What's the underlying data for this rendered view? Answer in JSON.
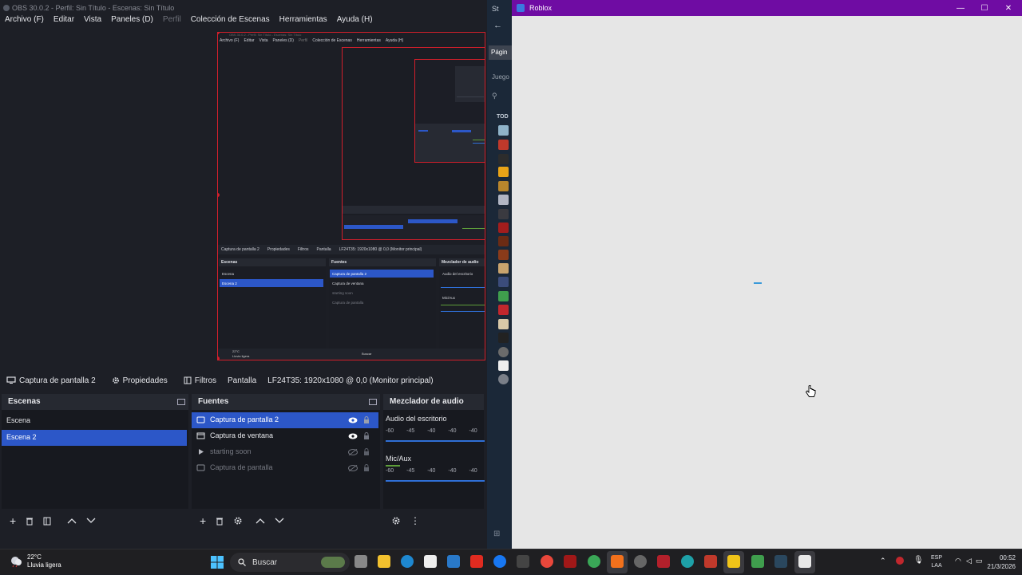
{
  "obs": {
    "title": "OBS 30.0.2 - Perfil: Sin Título - Escenas: Sin Título",
    "menu": [
      "Archivo (F)",
      "Editar",
      "Vista",
      "Paneles (D)",
      "Perfil",
      "Colección de Escenas",
      "Herramientas",
      "Ayuda (H)"
    ],
    "source_toolbar": {
      "selected_source": "Captura de pantalla 2",
      "properties": "Propiedades",
      "filters": "Filtros",
      "display_label": "Pantalla",
      "display_value": "LF24T35: 1920x1080 @ 0,0 (Monitor principal)"
    },
    "scenes": {
      "title": "Escenas",
      "items": [
        {
          "label": "Escena",
          "selected": false
        },
        {
          "label": "Escena 2",
          "selected": true
        }
      ]
    },
    "sources": {
      "title": "Fuentes",
      "items": [
        {
          "label": "Captura de pantalla 2",
          "selected": true,
          "visible": true,
          "type": "monitor"
        },
        {
          "label": "Captura de ventana",
          "selected": false,
          "visible": true,
          "type": "window"
        },
        {
          "label": "starting soon",
          "selected": false,
          "visible": false,
          "type": "media"
        },
        {
          "label": "Captura de pantalla",
          "selected": false,
          "visible": false,
          "type": "monitor"
        }
      ]
    },
    "mixer": {
      "title": "Mezclador de audio",
      "channels": [
        {
          "name": "Audio del escritorio",
          "ticks": [
            "-60",
            "-45",
            "-40",
            "-40",
            "-40"
          ]
        },
        {
          "name": "Mic/Aux",
          "ticks": [
            "-60",
            "-45",
            "-40",
            "-40",
            "-40"
          ]
        }
      ]
    },
    "inner_preview": {
      "title": "OBS 30.0.2 - Perfil: Sin Título - Escenas: Sin Título",
      "menu": [
        "Archivo (F)",
        "Editar",
        "Vista",
        "Paneles (D)",
        "Perfil",
        "Colección de Escenas",
        "Herramientas",
        "Ayuda (H)"
      ],
      "toolbar": [
        "Captura de pantalla 2",
        "Propiedades",
        "Filtros",
        "Pantalla",
        "LF24T35: 1920x1080 @ 0,0 (Monitor principal)"
      ],
      "scenes_title": "Escenas",
      "scenes": [
        "Escena",
        "Escena 2"
      ],
      "sources_title": "Fuentes",
      "sources": [
        "Captura de pantalla 2",
        "Captura de ventana",
        "starting soon",
        "Captura de pantalla"
      ],
      "mixer_title": "Mezclador de audio",
      "mixer_channels": [
        "Audio del escritorio",
        "Mic/Aux"
      ],
      "weather": "22°C",
      "weather_desc": "Lluvia ligera",
      "search": "Buscar"
    }
  },
  "steam": {
    "title": "St",
    "tab_label": "Págin",
    "section": "Juego",
    "filter": "TOD"
  },
  "roblox": {
    "title": "Roblox",
    "minimize": "—",
    "maximize": "☐",
    "close": "✕",
    "accent": "#6f0ca3"
  },
  "taskbar": {
    "weather_temp": "22°C",
    "weather_desc": "Lluvia ligera",
    "search_placeholder": "Buscar",
    "lang_top": "ESP",
    "lang_bottom": "LAA",
    "time": "00:52",
    "date": "21/3/2026"
  }
}
